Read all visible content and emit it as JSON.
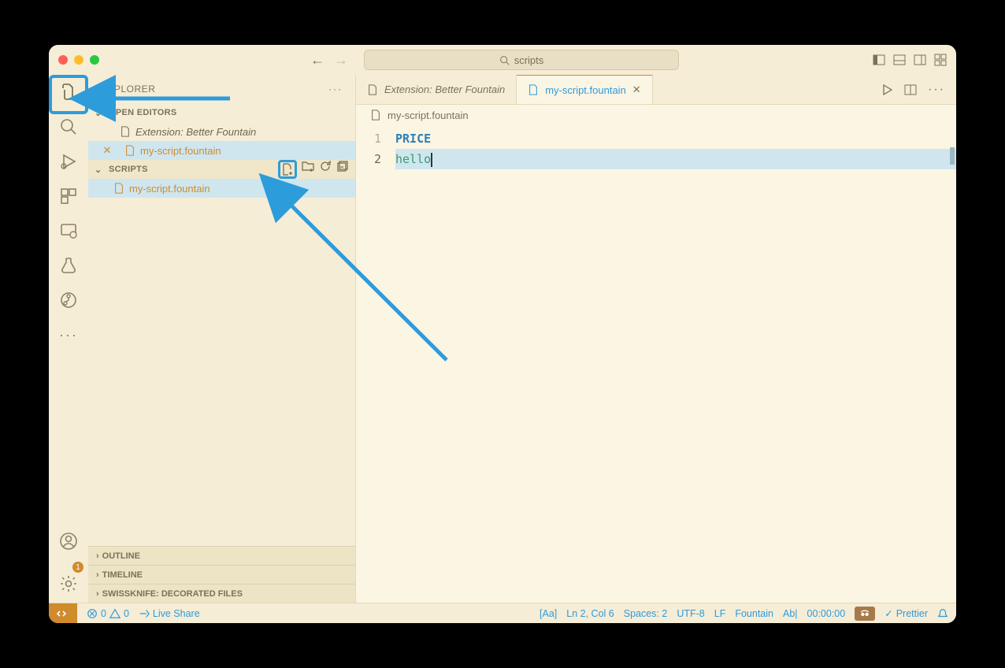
{
  "titlebar": {
    "search_text": "scripts"
  },
  "sidebar": {
    "title": "EXPLORER",
    "sections": {
      "open_editors": {
        "label": "OPEN EDITORS",
        "items": [
          {
            "name": "Extension: Better Fountain",
            "modified": false,
            "active": false
          },
          {
            "name": "my-script.fountain",
            "modified": true,
            "active": true
          }
        ]
      },
      "scripts": {
        "label": "SCRIPTS",
        "items": [
          {
            "name": "my-script.fountain",
            "active": true
          }
        ]
      },
      "outline": {
        "label": "OUTLINE"
      },
      "timeline": {
        "label": "TIMELINE"
      },
      "swissknife": {
        "label": "SWISSKNIFE: DECORATED FILES"
      }
    }
  },
  "tabs": [
    {
      "label": "Extension: Better Fountain",
      "active": false
    },
    {
      "label": "my-script.fountain",
      "active": true
    }
  ],
  "breadcrumb": "my-script.fountain",
  "code": {
    "line_numbers": [
      "1",
      "2"
    ],
    "line1": "PRICE",
    "line2": "hello"
  },
  "statusbar": {
    "errors": "0",
    "warnings": "0",
    "live_share": "Live Share",
    "aa": "[Aa]",
    "lncol": "Ln 2, Col 6",
    "spaces": "Spaces: 2",
    "encoding": "UTF-8",
    "eol": "LF",
    "lang": "Fountain",
    "ab": "Ab|",
    "time": "00:00:00",
    "prettier": "Prettier"
  },
  "activity_badge": "1"
}
